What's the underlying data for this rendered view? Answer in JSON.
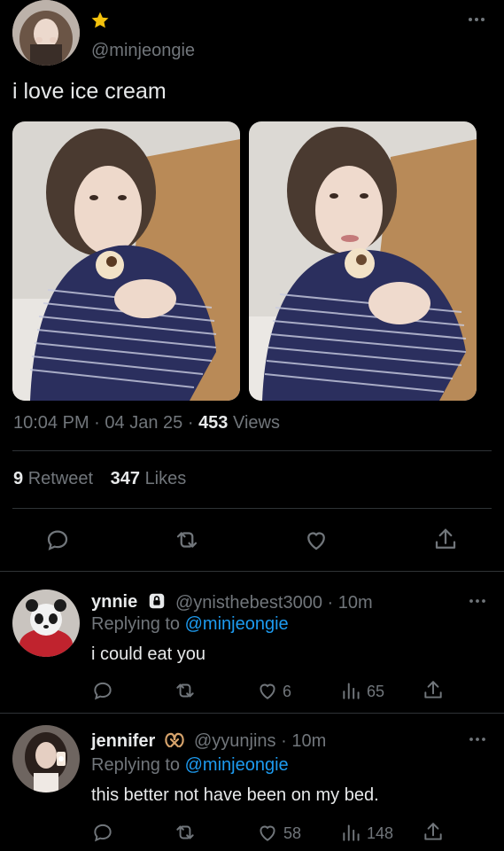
{
  "tweet": {
    "handle": "@minjeongie",
    "text": "i love ice cream",
    "time": "10:04 PM",
    "date": "04 Jan 25",
    "views_count": "453",
    "views_label": "Views",
    "retweets_count": "9",
    "retweets_label": "Retweet",
    "likes_count": "347",
    "likes_label": "Likes",
    "sep": "·"
  },
  "replies": [
    {
      "name": "ynnie",
      "handle": "@ynisthebest3000",
      "time": "10m",
      "replying_prefix": "Replying to",
      "replying_to": "@minjeongie",
      "text": "i could eat you",
      "likes": "6",
      "views": "65"
    },
    {
      "name": "jennifer",
      "handle": "@yyunjins",
      "time": "10m",
      "replying_prefix": "Replying to",
      "replying_to": "@minjeongie",
      "text": "this better not have been on my bed.",
      "likes": "58",
      "views": "148"
    }
  ],
  "colors": {
    "background": "#000000",
    "text": "#e7e9ea",
    "muted": "#71767b",
    "link": "#1d9bf0",
    "star": "#f4c20d"
  }
}
